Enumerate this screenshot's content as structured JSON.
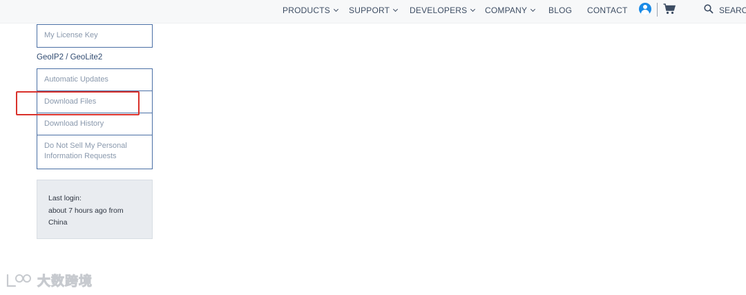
{
  "nav": {
    "items": [
      {
        "label": "PRODUCTS",
        "dropdown": true
      },
      {
        "label": "SUPPORT",
        "dropdown": true
      },
      {
        "label": "DEVELOPERS",
        "dropdown": true
      },
      {
        "label": "COMPANY",
        "dropdown": true
      },
      {
        "label": "BLOG",
        "dropdown": false
      },
      {
        "label": "CONTACT",
        "dropdown": false
      }
    ],
    "search_label": "SEARCH",
    "icons": {
      "account": "account-icon",
      "cart": "cart-icon",
      "search": "search-icon"
    },
    "accent_color": "#1a8ae6"
  },
  "sidebar": {
    "top_items": [
      "My License Key"
    ],
    "section_heading": "GeoIP2 / GeoLite2",
    "section_items": [
      "Automatic Updates",
      "Download Files",
      "Download History",
      "Do Not Sell My Personal Information Requests"
    ],
    "highlighted_item": "Download Files",
    "highlight_color": "#d9312b"
  },
  "login_info": {
    "line1": "Last login:",
    "line2": "about 7 hours ago from",
    "line3": "China"
  },
  "watermark": {
    "text": "大数跨境"
  }
}
